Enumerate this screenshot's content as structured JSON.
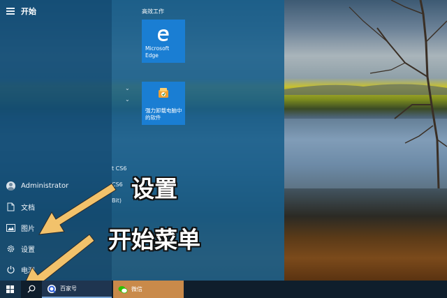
{
  "start_menu": {
    "title": "开始",
    "group_title": "高效工作",
    "tiles": [
      {
        "label": "Microsoft Edge",
        "icon": "edge-icon"
      },
      {
        "label": "强力卸载电脑中的软件",
        "icon": "uninstaller-icon"
      }
    ],
    "app_list_fragments": [
      "t CS6",
      "CS6",
      "Bit)"
    ],
    "left_rail": {
      "user": "Administrator",
      "documents": "文档",
      "pictures": "图片",
      "settings": "设置",
      "power": "电源"
    }
  },
  "annotations": {
    "settings_caption": "设置",
    "start_menu_caption": "开始菜单",
    "arrow_color": "#f2c26b"
  },
  "taskbar": {
    "apps": [
      {
        "label": "百家号",
        "icon": "baijiahao-icon"
      },
      {
        "label": "微信",
        "icon": "wechat-icon"
      }
    ]
  }
}
